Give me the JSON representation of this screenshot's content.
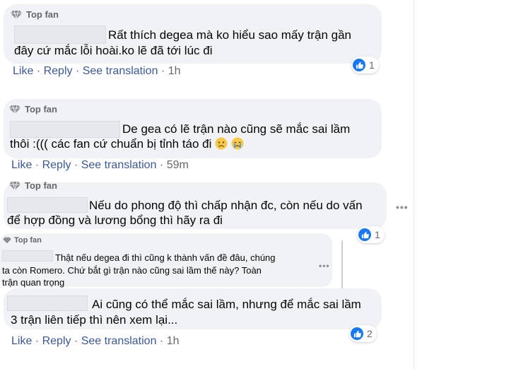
{
  "comments": [
    {
      "badge": "Top fan",
      "line1": "Rất thích degea mà ko hiểu sao mấy trận gần",
      "line2": "đây cứ mắc lỗi hoài.ko lẽ đã tới lúc đi",
      "like": "Like",
      "reply": "Reply",
      "translate": "See translation",
      "time": "1h",
      "reaction_count": "1"
    },
    {
      "badge": "Top fan",
      "line1": "De gea có lẽ trận nào cũng sẽ mắc sai lầm",
      "line2": "thôi :((( các fan cứ chuẩn bị tỉnh táo đi",
      "like": "Like",
      "reply": "Reply",
      "translate": "See translation",
      "time": "59m"
    },
    {
      "badge": "Top fan",
      "line1": "Nếu do phong độ thì chấp nhận đc, còn nếu do vấn",
      "line2": "để hợp đồng và lương bổng thì hãy ra đi",
      "reaction_count": "1"
    },
    {
      "badge": "Top fan",
      "line1": "Thật nếu degea đi thì cũng k thành vấn đề đâu, chúng",
      "line2": "ta còn Romero. Chứ bắt gì trận nào cũng sai lầm thế này? Toàn",
      "line3": "trận quan trọng"
    },
    {
      "line1": "Ai cũng có thể mắc sai lầm, nhưng để mắc sai lầm",
      "line2": "3 trận liên tiếp thì nên xem lại...",
      "like": "Like",
      "reply": "Reply",
      "translate": "See translation",
      "time": "1h",
      "reaction_count": "2"
    }
  ],
  "icons": {
    "badge": "diamond-icon",
    "reaction": "thumbs-up-icon",
    "more": "more-options-icon",
    "emoji": "crying-face-icon"
  },
  "colors": {
    "bubble": "#f0f2f5",
    "link": "#3b5998",
    "like_blue": "#1877f2",
    "meta": "#65676b"
  }
}
